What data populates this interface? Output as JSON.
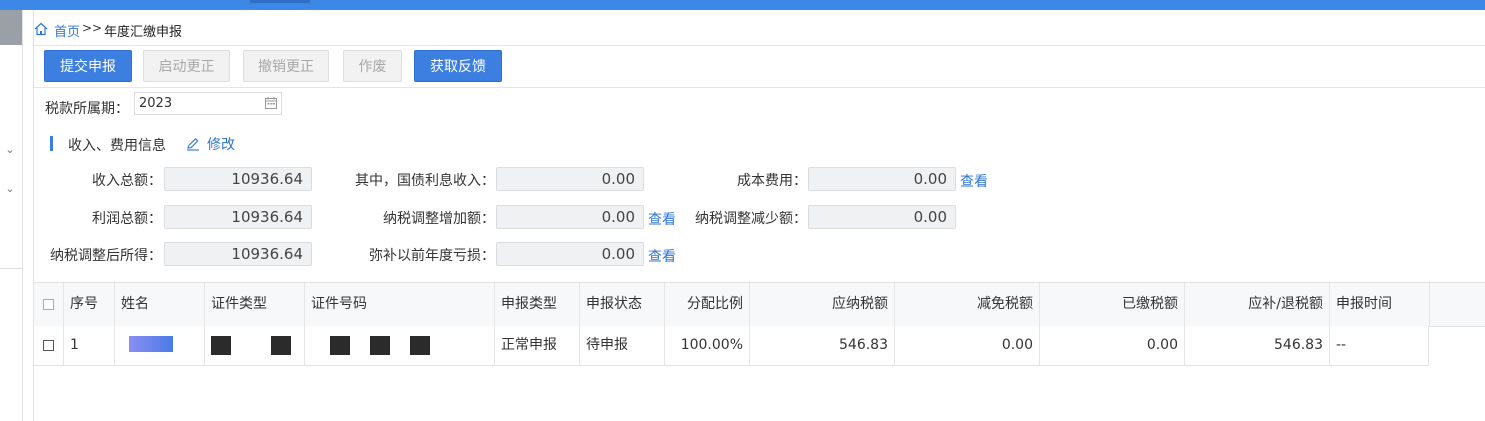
{
  "breadcrumb": {
    "home": "首页",
    "separator": ">>",
    "current": "年度汇缴申报"
  },
  "toolbar": {
    "submit": "提交申报",
    "start_correction": "启动更正",
    "cancel_correction": "撤销更正",
    "void": "作废",
    "get_feedback": "获取反馈"
  },
  "period": {
    "label": "税款所属期：",
    "value": "2023"
  },
  "section": {
    "title": "收入、费用信息",
    "edit": "修改"
  },
  "fields": {
    "total_income": {
      "label": "收入总额：",
      "value": "10936.64"
    },
    "gov_bond_interest": {
      "label": "其中，国债利息收入：",
      "value": "0.00"
    },
    "cost_expense": {
      "label": "成本费用：",
      "value": "0.00",
      "link": "查看"
    },
    "total_profit": {
      "label": "利润总额：",
      "value": "10936.64"
    },
    "tax_adjust_increase": {
      "label": "纳税调整增加额：",
      "value": "0.00",
      "link": "查看"
    },
    "tax_adjust_decrease": {
      "label": "纳税调整减少额：",
      "value": "0.00"
    },
    "adjusted_income": {
      "label": "纳税调整后所得：",
      "value": "10936.64"
    },
    "prior_loss_offset": {
      "label": "弥补以前年度亏损：",
      "value": "0.00",
      "link": "查看"
    }
  },
  "table": {
    "headers": [
      "序号",
      "姓名",
      "证件类型",
      "证件号码",
      "申报类型",
      "申报状态",
      "分配比例",
      "应纳税额",
      "减免税额",
      "已缴税额",
      "应补/退税额",
      "申报时间"
    ],
    "rows": [
      {
        "index": "1",
        "name": "",
        "id_type": "",
        "id_number": "",
        "decl_type": "正常申报",
        "decl_status": "待申报",
        "ratio": "100.00%",
        "tax_payable": "546.83",
        "tax_reduced": "0.00",
        "tax_paid": "0.00",
        "tax_due": "546.83",
        "decl_time": "--"
      }
    ]
  },
  "colors": {
    "accent": "#3d7fe0",
    "link": "#2f76d2",
    "disabled": "#a8a8a8"
  }
}
